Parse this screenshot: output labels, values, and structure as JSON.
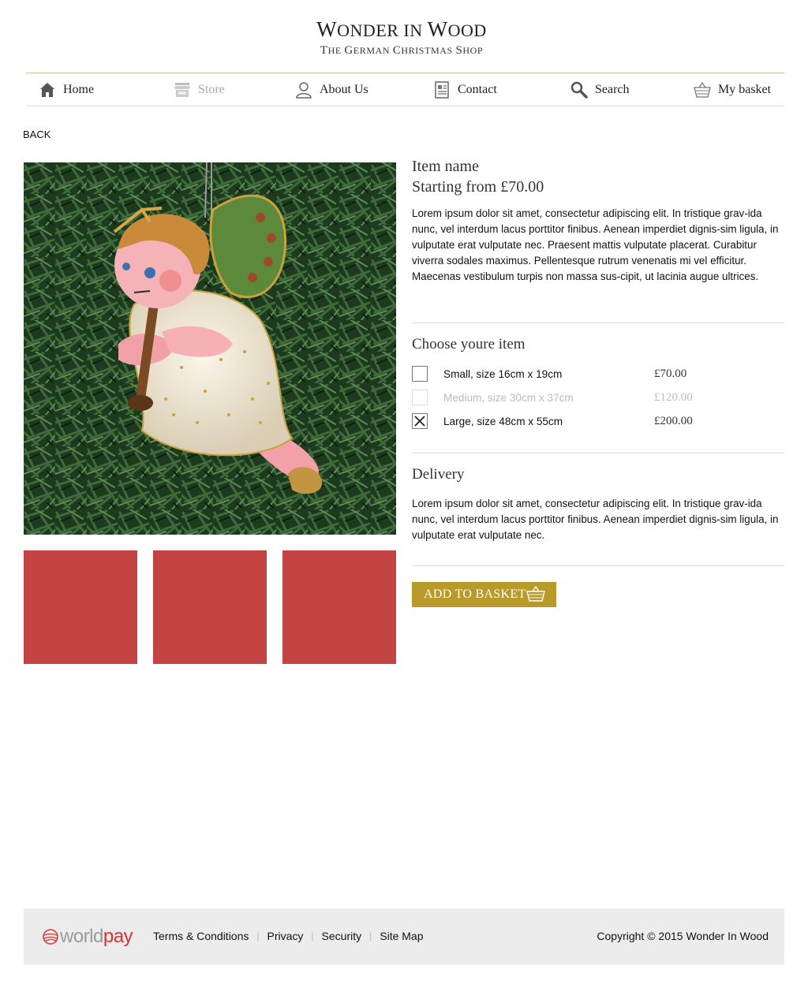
{
  "brand": {
    "title_parts": [
      "W",
      "ONDER IN ",
      "W",
      "OOD"
    ],
    "subtitle_parts": [
      "T",
      "HE ",
      "G",
      "ERMAN ",
      "C",
      "HRISTMAS ",
      "S",
      "HOP"
    ]
  },
  "nav": {
    "items": [
      {
        "label": "Home",
        "icon": "home-icon",
        "enabled": true
      },
      {
        "label": "Store",
        "icon": "store-icon",
        "enabled": false
      },
      {
        "label": "About Us",
        "icon": "user-icon",
        "enabled": true
      },
      {
        "label": "Contact",
        "icon": "contact-card-icon",
        "enabled": true
      },
      {
        "label": "Search",
        "icon": "search-icon",
        "enabled": true
      },
      {
        "label": "My basket",
        "icon": "basket-icon",
        "enabled": true
      }
    ]
  },
  "back_label": "BACK",
  "product": {
    "name": "Item name",
    "price_text": "Starting from £70.00",
    "description": "Lorem ipsum dolor sit amet, consectetur adipiscing elit. In tristique grav-ida nunc, vel interdum lacus porttitor finibus. Aenean imperdiet dignis-sim ligula, in vulputate erat vulputate nec. Praesent mattis vulputate placerat. Curabitur viverra sodales maximus. Pellentesque rutrum venenatis mi vel efficitur. Maecenas vestibulum turpis non massa sus-cipit, ut lacinia augue ultrices.",
    "image_alt": "photo of wooden angel ornament playing a flute",
    "thumbnails": [
      {
        "color": "#c44444"
      },
      {
        "color": "#c44444"
      },
      {
        "color": "#c44444"
      }
    ]
  },
  "choose": {
    "title": "Choose youre item",
    "options": [
      {
        "label": "Small, size 16cm x 19cm",
        "price": "£70.00",
        "checked": false,
        "disabled": false
      },
      {
        "label": "Medium, size 30cm x 37cm",
        "price": "£120.00",
        "checked": false,
        "disabled": true
      },
      {
        "label": "Large, size 48cm x 55cm",
        "price": "£200.00",
        "checked": true,
        "disabled": false
      }
    ]
  },
  "delivery": {
    "title": "Delivery",
    "text": "Lorem ipsum dolor sit amet, consectetur adipiscing elit. In tristique grav-ida nunc, vel interdum lacus porttitor finibus. Aenean imperdiet dignis-sim ligula, in vulputate erat vulputate nec."
  },
  "add_to_basket": "ADD TO BASKET",
  "colors": {
    "accent": "#b89a2a",
    "thumb": "#c44444",
    "footer_bg": "#ececec",
    "worldpay_red": "#d83333"
  },
  "footer": {
    "logo_world": "world",
    "logo_pay": "pay",
    "links": [
      "Terms & Conditions",
      "Privacy",
      "Security",
      "Site Map"
    ],
    "copyright": "Copyright  © 2015 Wonder In Wood"
  }
}
